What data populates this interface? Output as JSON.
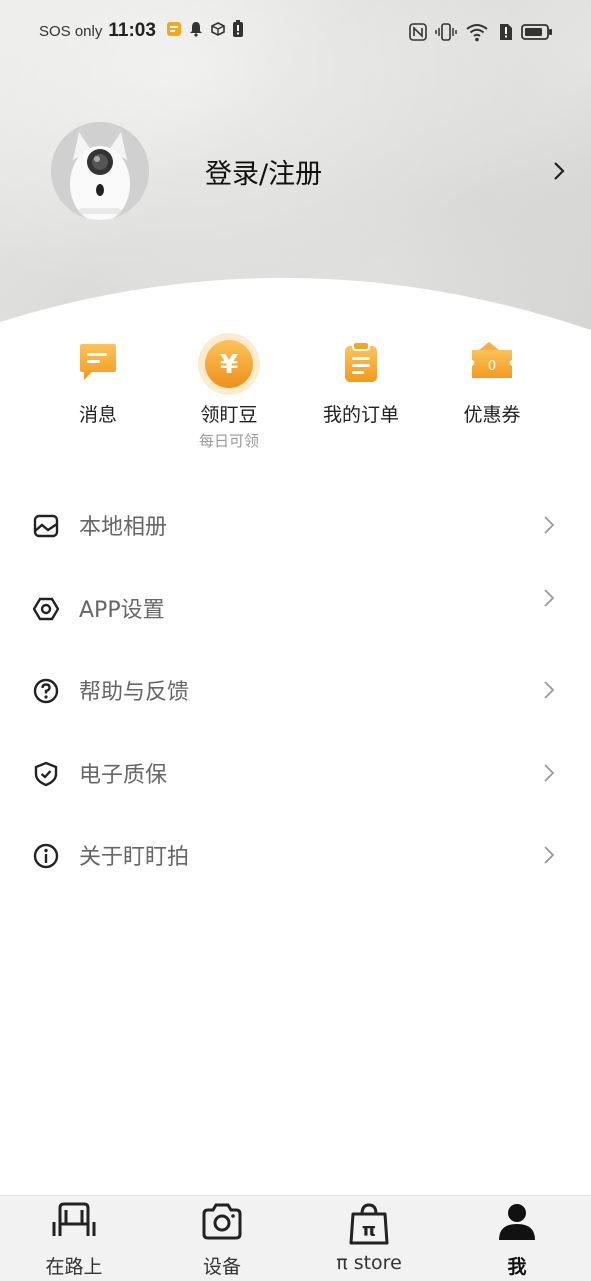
{
  "status_bar": {
    "carrier": "SOS only",
    "time": "11:03"
  },
  "profile": {
    "login_label": "登录/注册"
  },
  "quick_actions": [
    {
      "label": "消息",
      "sub": ""
    },
    {
      "label": "领盯豆",
      "sub": "每日可领"
    },
    {
      "label": "我的订单",
      "sub": ""
    },
    {
      "label": "优惠券",
      "sub": "",
      "badge": "0"
    }
  ],
  "coin_symbol": "¥",
  "menu": [
    {
      "label": "本地相册",
      "icon": "album-icon"
    },
    {
      "label": "APP设置",
      "icon": "settings-icon"
    },
    {
      "label": "帮助与反馈",
      "icon": "help-icon"
    },
    {
      "label": "电子质保",
      "icon": "shield-icon"
    },
    {
      "label": "关于盯盯拍",
      "icon": "info-icon"
    }
  ],
  "bottom_nav": [
    {
      "label": "在路上",
      "icon": "car-seat-icon"
    },
    {
      "label": "设备",
      "icon": "camera-icon"
    },
    {
      "label": "π store",
      "icon": "shopping-bag-icon",
      "glyph": "π"
    },
    {
      "label": "我",
      "icon": "person-icon",
      "active": true
    }
  ],
  "colors": {
    "accent_orange": "#F5A623",
    "text_dark": "#222222",
    "text_gray": "#666666"
  }
}
